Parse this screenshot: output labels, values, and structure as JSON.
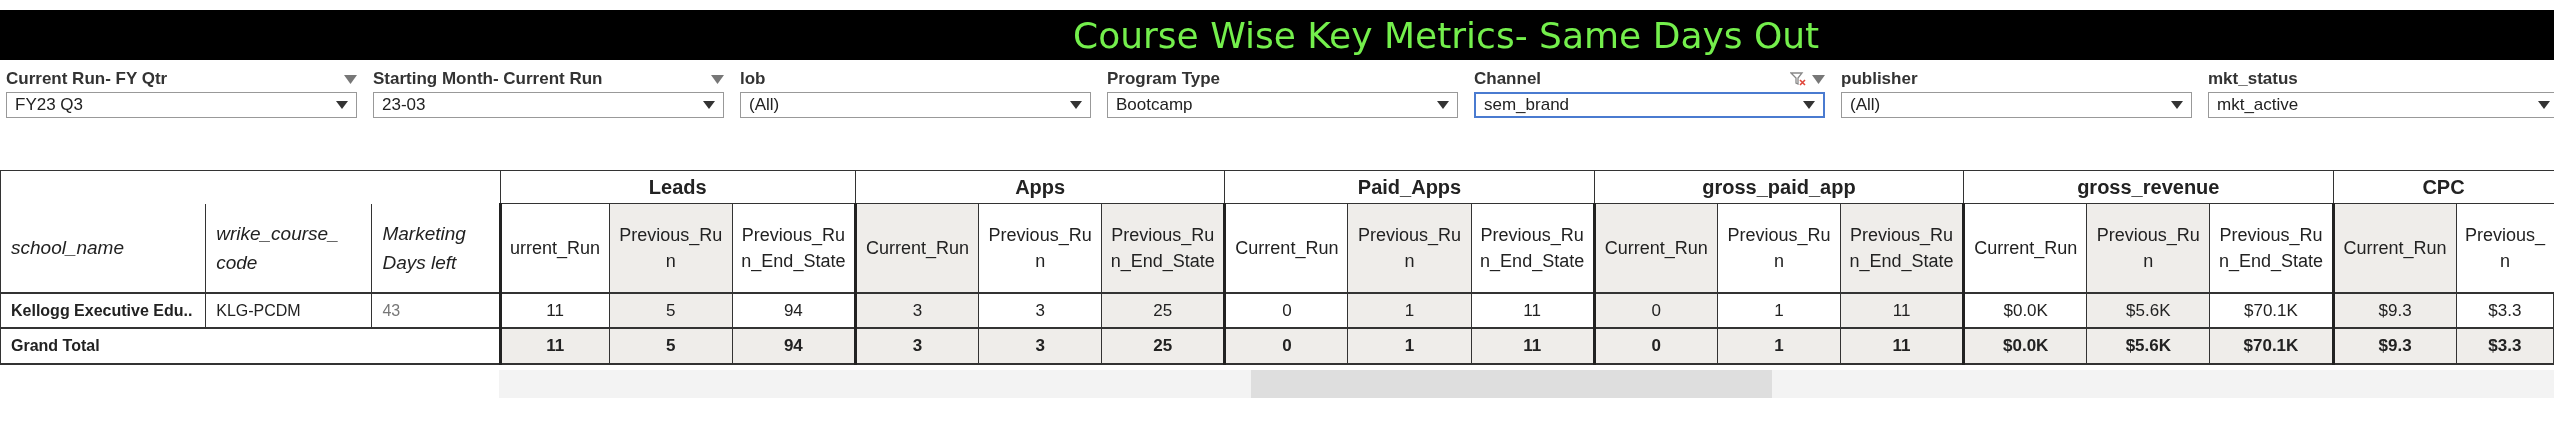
{
  "title": "Course Wise Key Metrics- Same Days Out",
  "filters": [
    {
      "label": "Current Run- FY Qtr",
      "value": "FY23 Q3",
      "header_menu": true,
      "clear_filter": false,
      "focused": false
    },
    {
      "label": "Starting Month- Current Run",
      "value": "23-03",
      "header_menu": true,
      "clear_filter": false,
      "focused": false
    },
    {
      "label": "lob",
      "value": "(All)",
      "header_menu": false,
      "clear_filter": false,
      "focused": false
    },
    {
      "label": "Program Type",
      "value": "Bootcamp",
      "header_menu": false,
      "clear_filter": false,
      "focused": false
    },
    {
      "label": "Channel",
      "value": "sem_brand",
      "header_menu": true,
      "clear_filter": true,
      "focused": true
    },
    {
      "label": "publisher",
      "value": "(All)",
      "header_menu": false,
      "clear_filter": false,
      "focused": false
    },
    {
      "label": "mkt_status",
      "value": "mkt_active",
      "header_menu": false,
      "clear_filter": false,
      "focused": false
    }
  ],
  "table": {
    "row_headers": [
      [
        "school_name"
      ],
      [
        "wrike_course_",
        "code"
      ],
      [
        "Marketing",
        "Days left"
      ]
    ],
    "groups": [
      {
        "name": "Leads",
        "columns": [
          [
            "urrent_Run"
          ],
          [
            "Previous_Ru",
            "n"
          ],
          [
            "Previous_Ru",
            "n_End_State"
          ]
        ]
      },
      {
        "name": "Apps",
        "columns": [
          [
            "Current_Run"
          ],
          [
            "Previous_Ru",
            "n"
          ],
          [
            "Previous_Ru",
            "n_End_State"
          ]
        ]
      },
      {
        "name": "Paid_Apps",
        "columns": [
          [
            "Current_Run"
          ],
          [
            "Previous_Ru",
            "n"
          ],
          [
            "Previous_Ru",
            "n_End_State"
          ]
        ]
      },
      {
        "name": "gross_paid_app",
        "columns": [
          [
            "Current_Run"
          ],
          [
            "Previous_Ru",
            "n"
          ],
          [
            "Previous_Ru",
            "n_End_State"
          ]
        ]
      },
      {
        "name": "gross_revenue",
        "columns": [
          [
            "Current_Run"
          ],
          [
            "Previous_Ru",
            "n"
          ],
          [
            "Previous_Ru",
            "n_End_State"
          ]
        ]
      },
      {
        "name": "CPC",
        "columns": [
          [
            "Current_Run"
          ],
          [
            "Previous_",
            "n"
          ]
        ]
      }
    ],
    "rows": [
      {
        "kind": "data",
        "cells": [
          "Kellogg Executive Edu..",
          "KLG-PCDM",
          "43"
        ],
        "values": [
          "11",
          "5",
          "94",
          "3",
          "3",
          "25",
          "0",
          "1",
          "11",
          "0",
          "1",
          "11",
          "$0.0K",
          "$5.6K",
          "$70.1K",
          "$9.3",
          "$3.3"
        ]
      },
      {
        "kind": "total",
        "cells": [
          {
            "text": "Grand Total",
            "colspan": 3
          }
        ],
        "values": [
          "11",
          "5",
          "94",
          "3",
          "3",
          "25",
          "0",
          "1",
          "11",
          "0",
          "1",
          "11",
          "$0.0K",
          "$5.6K",
          "$70.1K",
          "$9.3",
          "$3.3"
        ]
      }
    ]
  }
}
